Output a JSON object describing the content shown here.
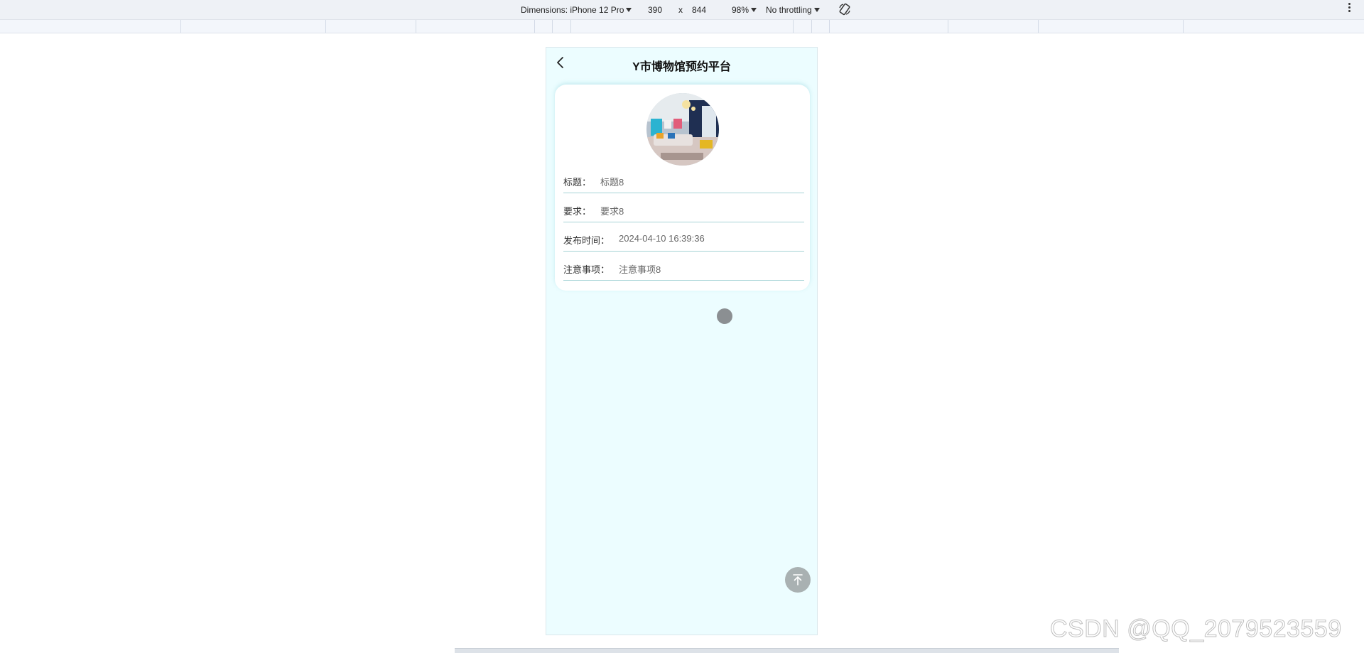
{
  "devtools": {
    "dimensions_label": "Dimensions: iPhone 12 Pro",
    "width": "390",
    "times": "x",
    "height": "844",
    "zoom": "98%",
    "throttling": "No throttling"
  },
  "app": {
    "title": "Y市博物馆预约平台"
  },
  "detail": {
    "rows": [
      {
        "label": "标题：",
        "value": "标题8"
      },
      {
        "label": "要求：",
        "value": "要求8"
      },
      {
        "label": "发布时间：",
        "value": "2024-04-10 16:39:36"
      },
      {
        "label": "注意事项：",
        "value": "注意事项8"
      }
    ]
  },
  "watermark": "CSDN @QQ_2079523559",
  "icons": {
    "back": "chevron-left-icon",
    "back_to_top": "arrow-up-icon",
    "rotate": "rotate-icon",
    "menu": "more-vertical-icon"
  },
  "colors": {
    "device_bg": "#ecfdff",
    "divider": "#a6d3d6",
    "back_top_bg": "#a9b1b2"
  }
}
